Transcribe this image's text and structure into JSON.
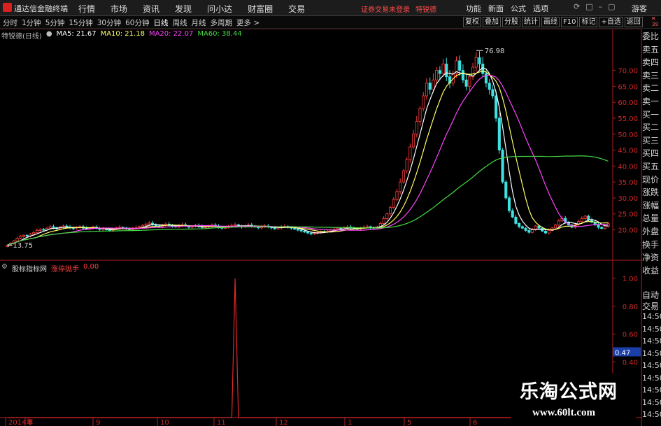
{
  "window": {
    "app_title": "通达信金融终端",
    "main_menu": [
      "行情",
      "市场",
      "资讯",
      "发现",
      "问小达",
      "财富圈",
      "交易"
    ],
    "status_warning": "证券交易未登录",
    "stock_short": "特锐德",
    "right_menu": [
      "功能",
      "新面",
      "公式",
      "选项"
    ],
    "guest_label": "游客"
  },
  "toolbar": {
    "periods": [
      "分时",
      "1分钟",
      "5分钟",
      "15分钟",
      "30分钟",
      "60分钟",
      "日线",
      "周线",
      "月线",
      "多周期",
      "更多 >"
    ],
    "active_period": "日线",
    "tools": [
      "复权",
      "叠加",
      "分股",
      "统计",
      "画线",
      "F10",
      "标记",
      "+自选",
      "返回"
    ]
  },
  "chart_legend": {
    "stock_label": "特锐德(日线)",
    "ma": [
      {
        "label": "MA5: 21.67",
        "color": "#ffffff"
      },
      {
        "label": "MA10: 21.18",
        "color": "#ffff66"
      },
      {
        "label": "MA20: 22.07",
        "color": "#ff44ff"
      },
      {
        "label": "MA60: 38.44",
        "color": "#44dd44"
      }
    ]
  },
  "right_panel": {
    "corner": "R 39",
    "items": [
      "委比",
      "卖五",
      "卖四",
      "卖三",
      "卖二",
      "卖一",
      "买一",
      "买二",
      "买三",
      "买四",
      "买五",
      "现价",
      "涨跌",
      "涨幅",
      "总量",
      "外盘",
      "换手",
      "净资",
      "收益"
    ],
    "auto_trade": [
      "自动",
      "交易"
    ],
    "times": [
      "14:50",
      "14:50",
      "14:50",
      "14:50",
      "14:50",
      "14:50",
      "14:50",
      "14:50",
      "14:50"
    ]
  },
  "indicator_legend": {
    "name": "股标指标网",
    "series_label": "涨停抛手",
    "value": "0.00"
  },
  "chart_data": {
    "type": "candlestick",
    "price_axis": {
      "ylim": [
        12,
        80
      ],
      "ticks": [
        20,
        25,
        30,
        35,
        40,
        45,
        50,
        55,
        60,
        65,
        70
      ]
    },
    "low_label": "13.75",
    "high_label": "76.98",
    "x_labels": [
      "2014年",
      "8",
      "9",
      "10",
      "11",
      "12",
      "1",
      "5",
      "6"
    ],
    "closes": [
      15.2,
      15.8,
      16.5,
      17.4,
      17.9,
      18.3,
      18.0,
      18.6,
      19.1,
      19.8,
      20.2,
      19.9,
      20.5,
      21.0,
      20.7,
      20.3,
      20.8,
      21.2,
      20.9,
      20.6,
      20.4,
      20.7,
      21.0,
      20.5,
      20.2,
      20.6,
      20.9,
      20.4,
      20.1,
      20.3,
      20.0,
      19.8,
      20.2,
      20.5,
      20.8,
      20.6,
      20.3,
      20.1,
      20.4,
      20.7,
      21.0,
      21.4,
      21.8,
      22.1,
      21.7,
      21.3,
      21.0,
      21.4,
      21.8,
      21.5,
      21.2,
      20.9,
      21.3,
      21.6,
      21.2,
      20.8,
      21.1,
      21.4,
      21.0,
      20.7,
      20.9,
      21.2,
      21.5,
      21.1,
      20.8,
      20.5,
      20.8,
      21.1,
      21.4,
      21.6,
      21.2,
      20.9,
      21.2,
      21.5,
      21.2,
      20.9,
      20.6,
      20.9,
      21.2,
      20.9,
      20.6,
      20.3,
      20.6,
      20.9,
      21.1,
      20.8,
      20.5,
      20.2,
      19.9,
      19.6,
      19.3,
      19.0,
      18.7,
      18.9,
      19.2,
      19.5,
      19.3,
      19.6,
      19.9,
      20.2,
      20.5,
      20.3,
      20.6,
      20.9,
      20.7,
      20.4,
      20.2,
      20.5,
      20.8,
      21.0,
      20.7,
      20.5,
      20.8,
      22.0,
      23.5,
      25.0,
      27.0,
      29.5,
      32.0,
      35.0,
      38.5,
      42.0,
      46.0,
      50.0,
      54.0,
      58.0,
      62.0,
      66.0,
      64.0,
      67.0,
      70.0,
      69.0,
      72.0,
      68.0,
      66.0,
      69.0,
      73.0,
      70.0,
      67.0,
      65.0,
      68.0,
      71.0,
      74.0,
      72.0,
      69.0,
      66.0,
      64.0,
      62.0,
      55.0,
      45.0,
      35.0,
      30.0,
      26.0,
      24.0,
      22.0,
      21.0,
      20.5,
      19.8,
      19.2,
      20.0,
      21.2,
      20.5,
      19.6,
      19.0,
      19.8,
      20.6,
      21.5,
      22.8,
      23.6,
      22.4,
      21.5,
      20.8,
      21.7,
      22.6,
      23.5,
      24.3,
      23.2,
      22.4,
      21.6,
      20.8,
      20.4,
      21.2,
      21.9
    ],
    "ma_series": [
      {
        "name": "MA5",
        "color": "#ffffff",
        "period": 5
      },
      {
        "name": "MA10",
        "color": "#ffff66",
        "period": 10
      },
      {
        "name": "MA20",
        "color": "#ff44ff",
        "period": 20
      },
      {
        "name": "MA60",
        "color": "#44dd44",
        "period": 60
      }
    ],
    "indicator": {
      "ylim": [
        0,
        1.05
      ],
      "ticks": [
        "1.00",
        "0.80",
        "0.60",
        "0.40"
      ],
      "cursor_value": "0.47",
      "spike_index": 69,
      "spike_value": 1.0
    }
  }
}
